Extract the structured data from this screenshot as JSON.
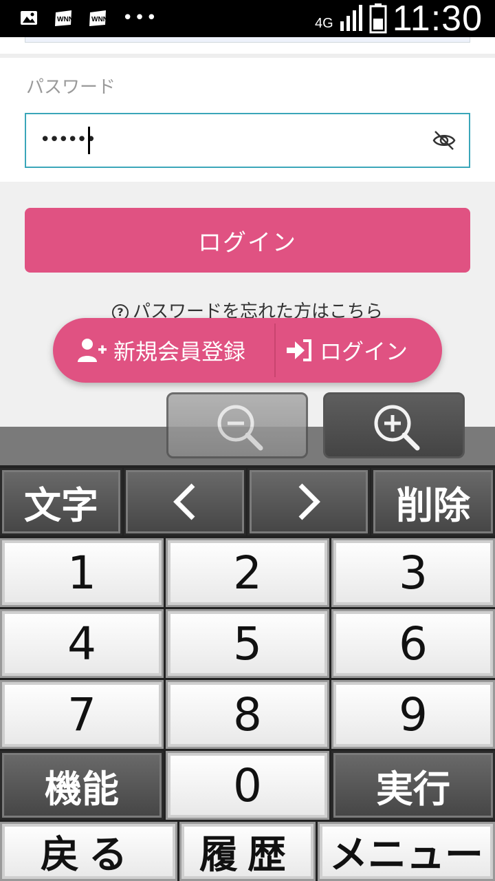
{
  "status_bar": {
    "left_icons": [
      "gallery-icon",
      "wnn-icon",
      "wnn-icon",
      "more-dots-icon"
    ],
    "dots": "•••",
    "network": "4G",
    "time": "11:30"
  },
  "form": {
    "password_label": "パスワード",
    "password_value": "••••••",
    "login_button": "ログイン",
    "forgot_link": "パスワードを忘れた方はこちら"
  },
  "floating_bar": {
    "register_label": "新規会員登録",
    "login_label": "ログイン"
  },
  "keypad": {
    "top_row": {
      "chars": "文字",
      "left": "＜",
      "right": "＞",
      "delete": "削除"
    },
    "digits": [
      "1",
      "2",
      "3",
      "4",
      "5",
      "6",
      "7",
      "8",
      "9"
    ],
    "function": "機能",
    "zero": "0",
    "execute": "実行",
    "bottom_row": {
      "back": "戻る",
      "history": "履歴",
      "menu": "メニュー"
    }
  },
  "colors": {
    "accent_pink": "#e05282",
    "input_border": "#3aa6b9"
  }
}
